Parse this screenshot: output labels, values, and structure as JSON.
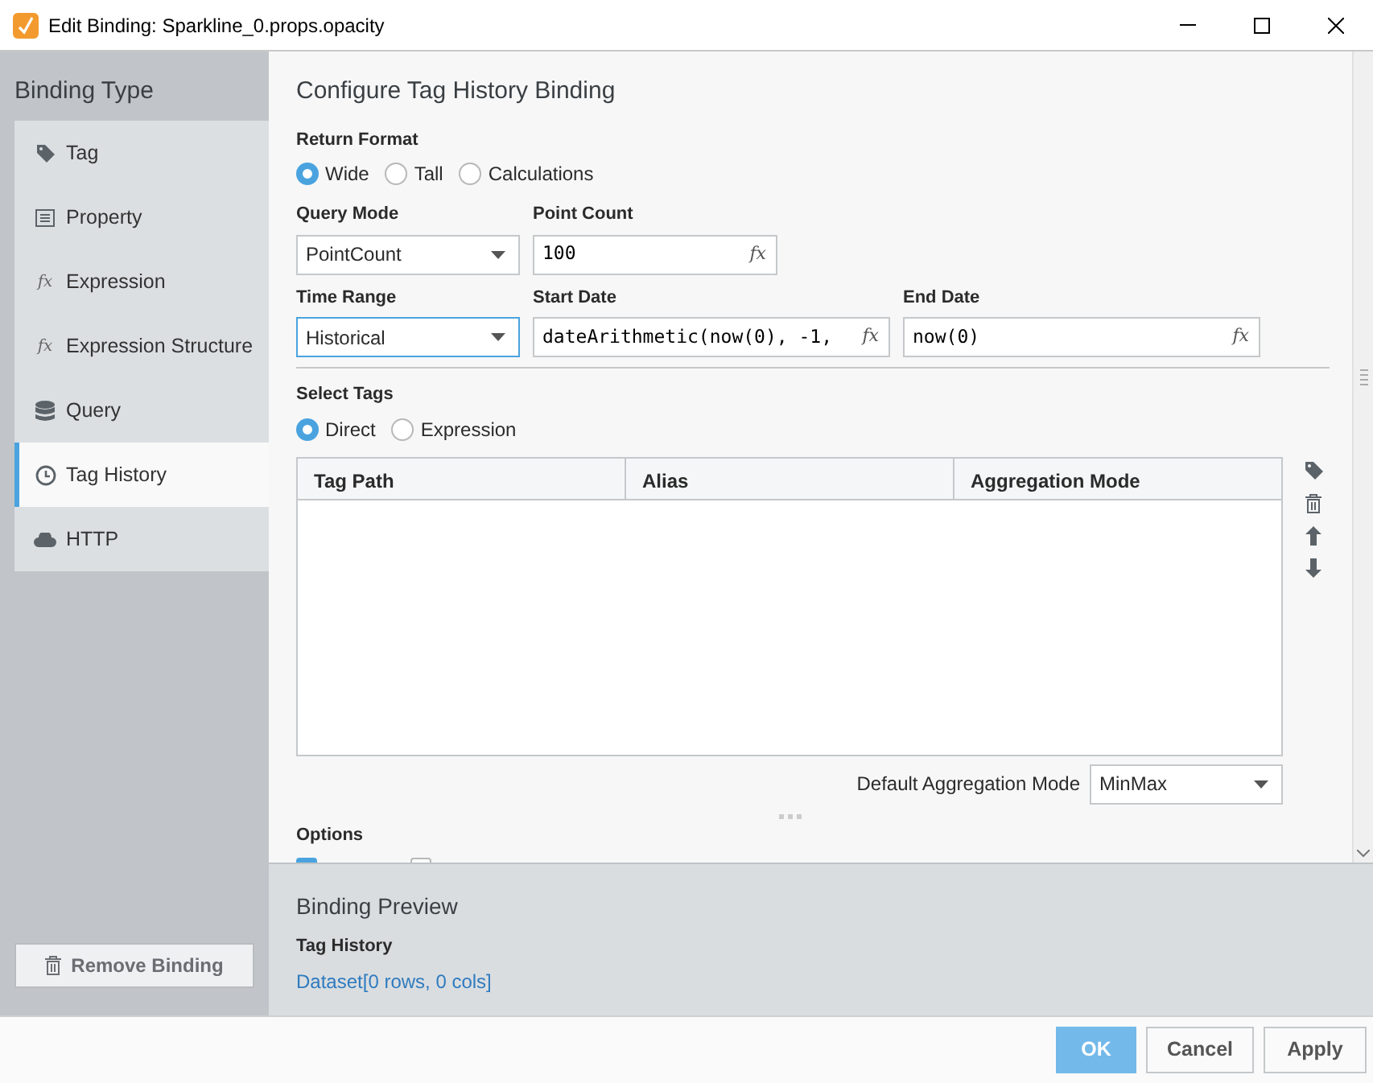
{
  "window": {
    "title": "Edit Binding: Sparkline_0.props.opacity"
  },
  "sidebar": {
    "title": "Binding Type",
    "items": [
      {
        "label": "Tag",
        "kind": "tag",
        "selected": false
      },
      {
        "label": "Property",
        "kind": "property",
        "selected": false
      },
      {
        "label": "Expression",
        "kind": "fx",
        "icon_glyph": "fx",
        "selected": false
      },
      {
        "label": "Expression Structure",
        "kind": "fx",
        "icon_glyph": "fx",
        "selected": false
      },
      {
        "label": "Query",
        "kind": "database",
        "selected": false
      },
      {
        "label": "Tag History",
        "kind": "clock",
        "selected": true
      },
      {
        "label": "HTTP",
        "kind": "cloud",
        "selected": false
      }
    ],
    "remove_button": "Remove Binding"
  },
  "config": {
    "title": "Configure Tag History Binding",
    "return_format": {
      "label": "Return Format",
      "options": [
        {
          "label": "Wide",
          "selected": true
        },
        {
          "label": "Tall",
          "selected": false
        },
        {
          "label": "Calculations",
          "selected": false
        }
      ]
    },
    "query_mode": {
      "label": "Query Mode",
      "value": "PointCount",
      "focused": false
    },
    "point_count": {
      "label": "Point Count",
      "value": "100",
      "fx": "fx"
    },
    "time_range": {
      "label": "Time Range",
      "value": "Historical",
      "focused": true
    },
    "start_date": {
      "label": "Start Date",
      "value": "dateArithmetic(now(0), -1,",
      "fx": "fx"
    },
    "end_date": {
      "label": "End Date",
      "value": "now(0)",
      "fx": "fx"
    },
    "select_tags": {
      "label": "Select Tags",
      "options": [
        {
          "label": "Direct",
          "selected": true
        },
        {
          "label": "Expression",
          "selected": false
        }
      ]
    },
    "table": {
      "columns": [
        "Tag Path",
        "Alias",
        "Aggregation Mode"
      ]
    },
    "default_aggregation": {
      "label": "Default Aggregation Mode",
      "value": "MinMax",
      "focused": false
    },
    "options": {
      "label": "Options",
      "items": [
        {
          "checked": true
        },
        {
          "checked": false
        }
      ]
    }
  },
  "preview": {
    "title": "Binding Preview",
    "label": "Tag History",
    "value": "Dataset[0 rows, 0 cols]"
  },
  "buttons": [
    {
      "label": "OK",
      "primary": true
    },
    {
      "label": "Cancel",
      "primary": false
    },
    {
      "label": "Apply",
      "primary": false
    }
  ]
}
